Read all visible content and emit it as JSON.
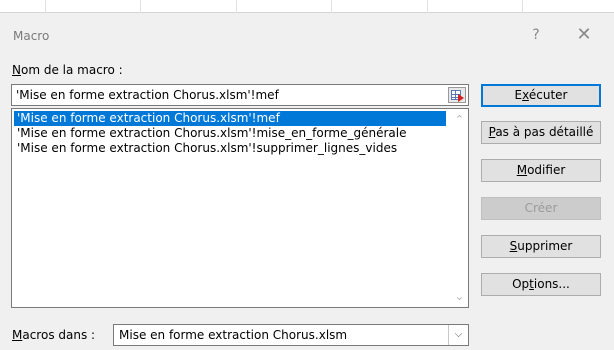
{
  "window": {
    "title": "Macro",
    "help_glyph": "?",
    "close_glyph": "✕"
  },
  "macro_name": {
    "label_prefix": "",
    "label_accel": "N",
    "label_rest": "om de la macro :",
    "value": "'Mise en forme extraction Chorus.xlsm'!mef"
  },
  "macro_list": {
    "items": [
      "'Mise en forme extraction Chorus.xlsm'!mef",
      "'Mise en forme extraction Chorus.xlsm'!mise_en_forme_générale",
      "'Mise en forme extraction Chorus.xlsm'!supprimer_lignes_vides"
    ],
    "selected_index": 0,
    "scroll_up_glyph": "⌃",
    "scroll_down_glyph": "⌄"
  },
  "buttons": {
    "run": {
      "pre": "E",
      "accel": "x",
      "post": "écuter",
      "enabled": true,
      "default": true
    },
    "step": {
      "pre": "",
      "accel": "P",
      "post": "as à pas détaillé",
      "enabled": true
    },
    "edit": {
      "pre": "",
      "accel": "M",
      "post": "odifier",
      "enabled": true
    },
    "create": {
      "pre": "",
      "accel": "",
      "post": "Créer",
      "enabled": false
    },
    "delete": {
      "pre": "",
      "accel": "S",
      "post": "upprimer",
      "enabled": true
    },
    "options": {
      "pre": "Op",
      "accel": "t",
      "post": "ions...",
      "enabled": true
    }
  },
  "macros_in": {
    "label_prefix": "",
    "label_accel": "M",
    "label_rest": "acros dans :",
    "value": "Mise en forme extraction Chorus.xlsm",
    "dropdown_glyph": "⌵"
  },
  "colors": {
    "selection": "#0078d7",
    "dialog_bg": "#f0f0f0"
  }
}
